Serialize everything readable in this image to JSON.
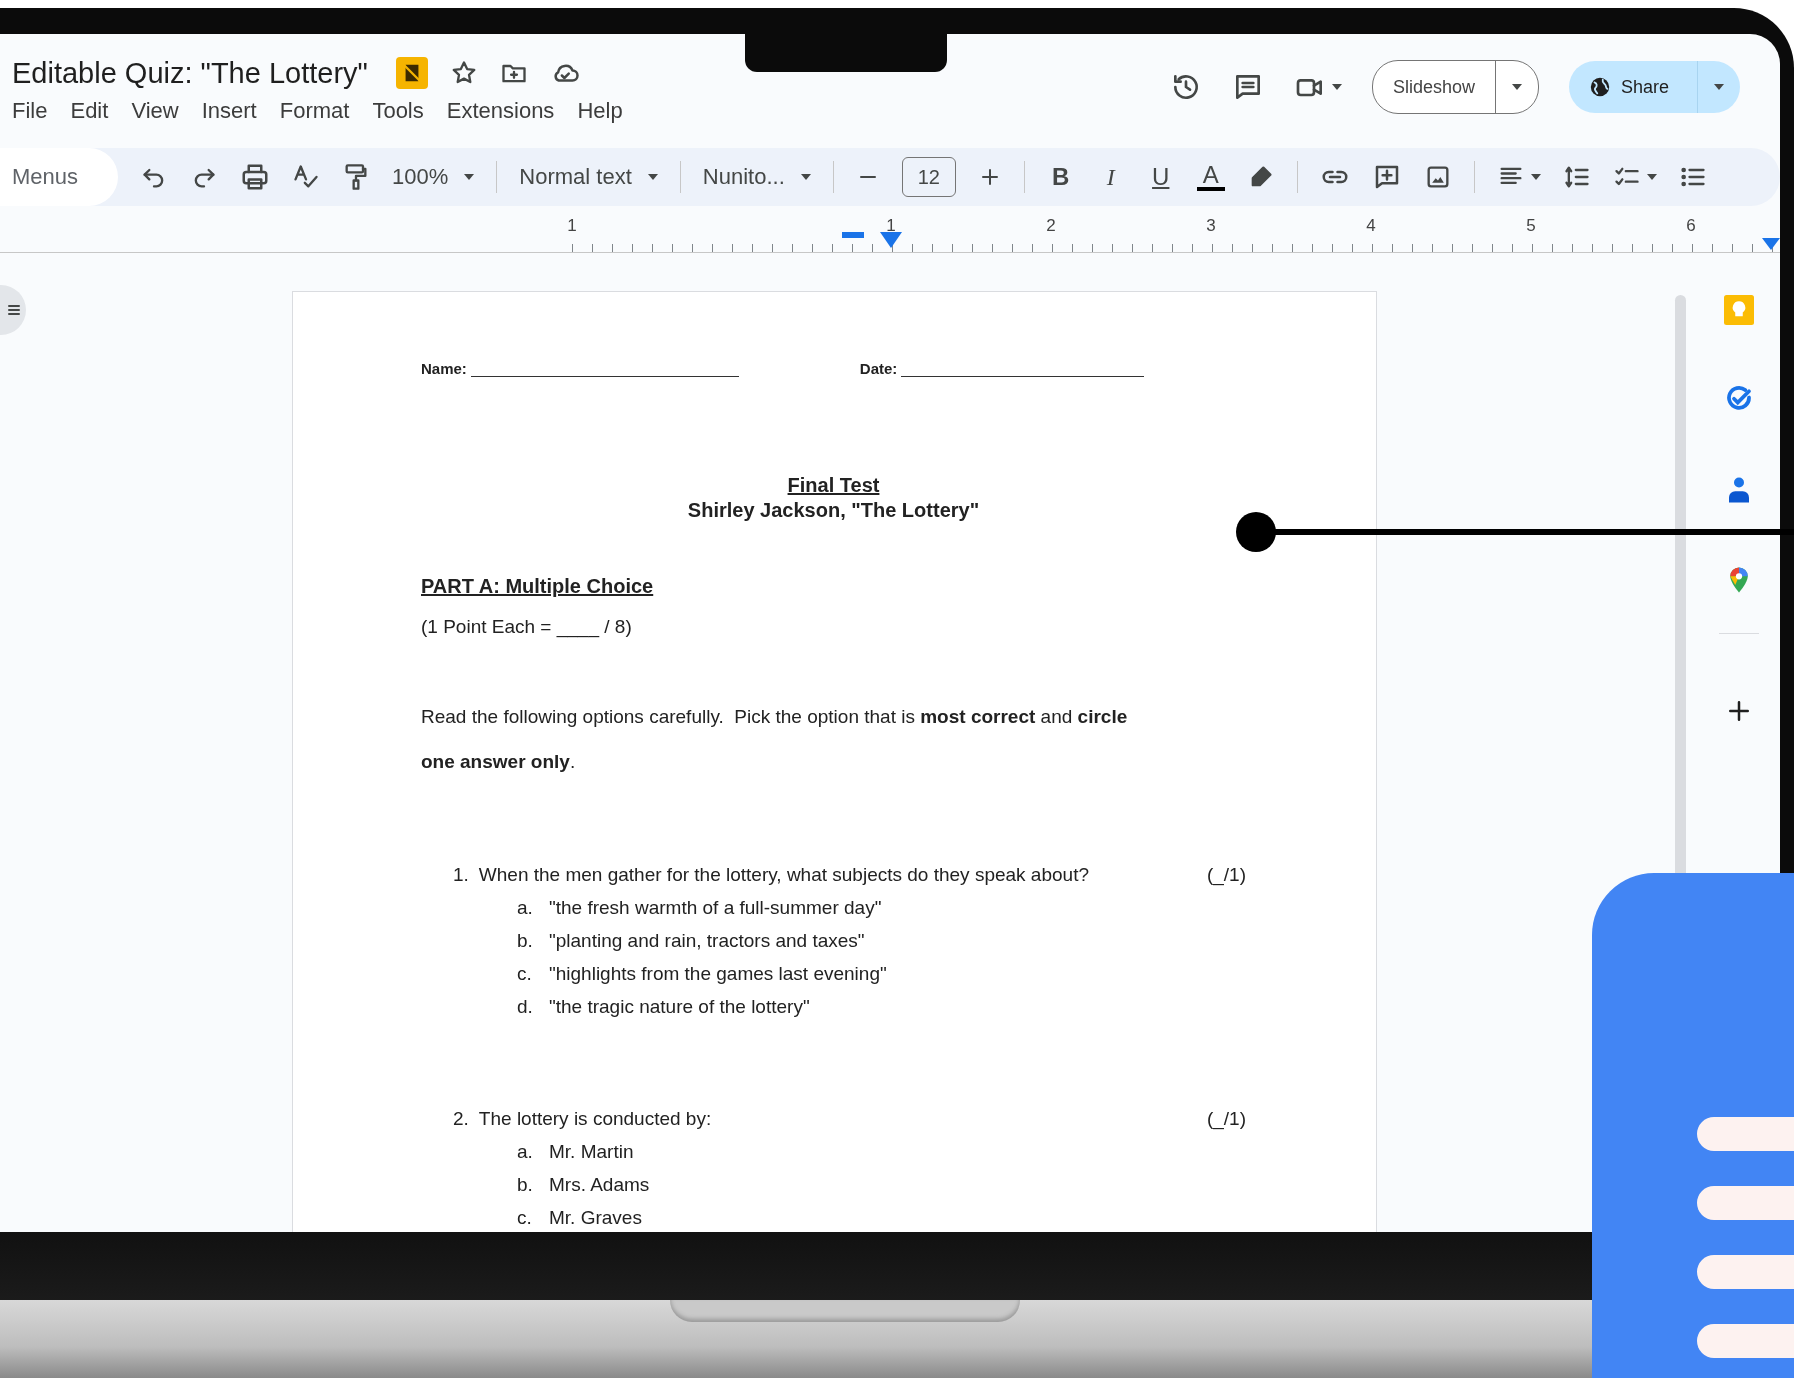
{
  "document": {
    "title": "Editable Quiz: \"The Lottery\""
  },
  "menu": [
    "File",
    "Edit",
    "View",
    "Insert",
    "Format",
    "Tools",
    "Extensions",
    "Help"
  ],
  "header_actions": {
    "slideshow": "Slideshow",
    "share": "Share"
  },
  "toolbar": {
    "menus": "Menus",
    "zoom": "100%",
    "style": "Normal text",
    "font": "Nunito...",
    "font_size": "12",
    "format": [
      {
        "kind": "bold",
        "label": "B"
      },
      {
        "kind": "italic",
        "label": "I"
      },
      {
        "kind": "underline",
        "label": "U"
      },
      {
        "kind": "text-color",
        "label": "A"
      }
    ]
  },
  "ruler": {
    "numbers": [
      "1",
      "1",
      "2",
      "3",
      "4",
      "5",
      "6"
    ]
  },
  "page": {
    "name_label": "Name:",
    "date_label": "Date:",
    "title": "Final Test",
    "subtitle": "Shirley Jackson, \"The Lottery\"",
    "section": "PART A: Multiple Choice",
    "points": "(1 Point Each = ____ / 8)",
    "instructions": "Read the following options carefully.  Pick the option that is **most correct** and **circle one answer only**.",
    "questions": [
      {
        "number": "1.",
        "text": "When the men gather for the lottery, what subjects do they speak about?",
        "score": "(_/1)",
        "options": [
          {
            "letter": "a.",
            "text": "\"the fresh warmth of a full-summer day\""
          },
          {
            "letter": "b.",
            "text": "\"planting and rain, tractors and taxes\""
          },
          {
            "letter": "c.",
            "text": "\"highlights from the games last evening\""
          },
          {
            "letter": "d.",
            "text": "\"the tragic nature of the lottery\""
          }
        ]
      },
      {
        "number": "2.",
        "text": "The lottery is conducted by:",
        "score": "(_/1)",
        "options": [
          {
            "letter": "a.",
            "text": "Mr. Martin"
          },
          {
            "letter": "b.",
            "text": "Mrs. Adams"
          },
          {
            "letter": "c.",
            "text": "Mr. Graves"
          }
        ]
      }
    ]
  }
}
